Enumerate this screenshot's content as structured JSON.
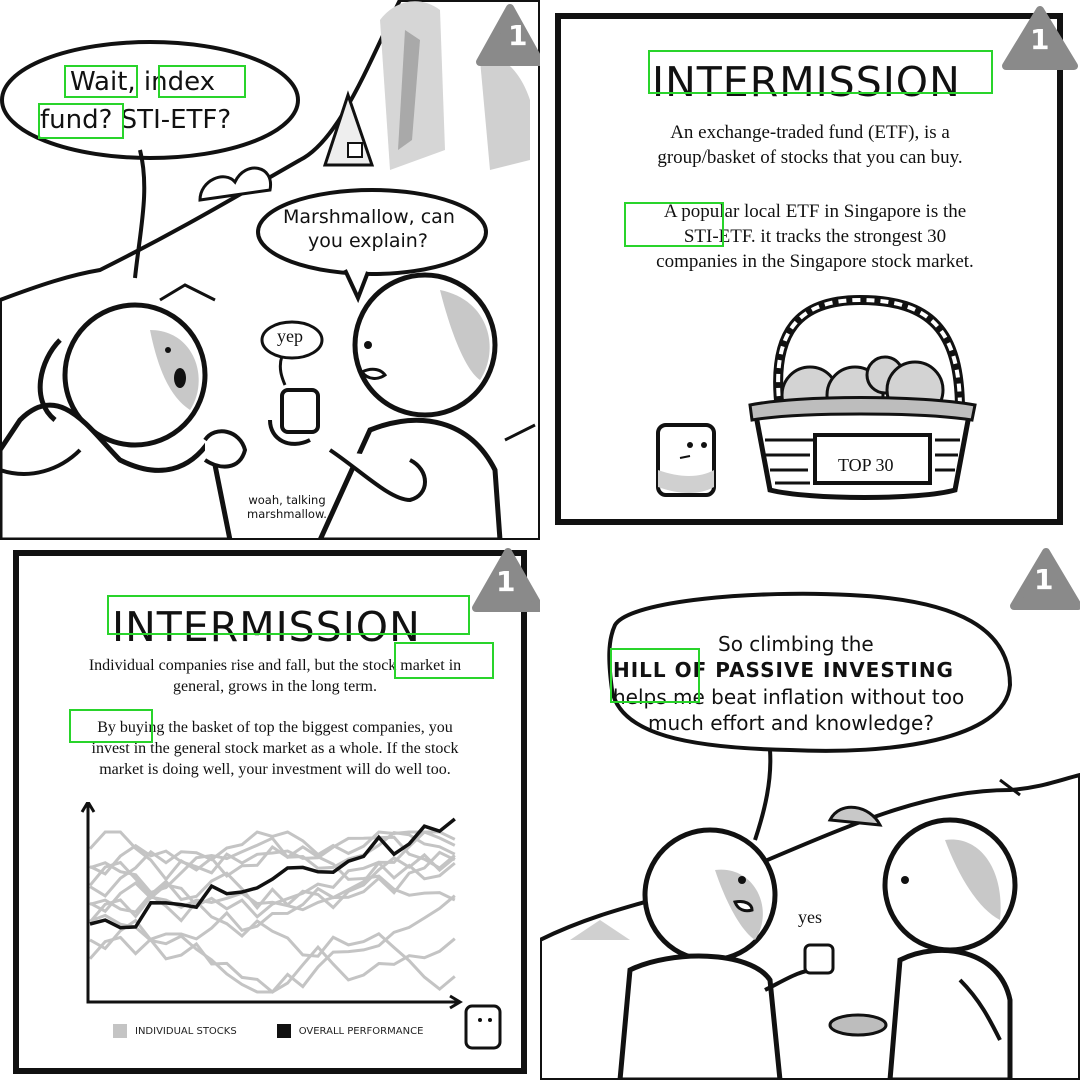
{
  "panel1": {
    "speech_main": [
      "Wait, index",
      "fund? STI-ETF?"
    ],
    "speech_right": [
      "Marshmallow, can",
      "you explain?"
    ],
    "yep": "yep",
    "woah": [
      "woah, talking",
      "marshmallow."
    ],
    "badge": "1"
  },
  "panel2": {
    "title": "INTERMISSION",
    "paragraph1": [
      "An exchange-traded fund (ETF), is a",
      "group/basket of stocks that you can buy."
    ],
    "paragraph2": [
      "A popular local ETF in Singapore is the",
      "STI-ETF. it tracks the strongest 30",
      "companies in the Singapore stock market."
    ],
    "basket_label": "TOP 30",
    "badge": "1"
  },
  "panel3": {
    "title": "INTERMISSION",
    "paragraph1": [
      "Individual companies rise and fall, but the stock market in",
      "general, grows in the long term."
    ],
    "paragraph2": [
      "By buying the basket of top the biggest companies, you",
      "invest in the general stock market as a whole. If the stock",
      "market is doing well, your investment will do well too."
    ],
    "legend": {
      "individual": "INDIVIDUAL STOCKS",
      "overall": "OVERALL PERFORMANCE"
    },
    "colors": {
      "individual": "#c4c4c4",
      "overall": "#111111"
    },
    "badge": "1"
  },
  "panel4": {
    "speech_line1": "So climbing the",
    "speech_line2_bold": "HILL OF PASSIVE INVESTING",
    "speech_line3": "helps me beat inflation without too",
    "speech_line4": "much effort and knowledge?",
    "yes": "yes",
    "badge": "1"
  }
}
